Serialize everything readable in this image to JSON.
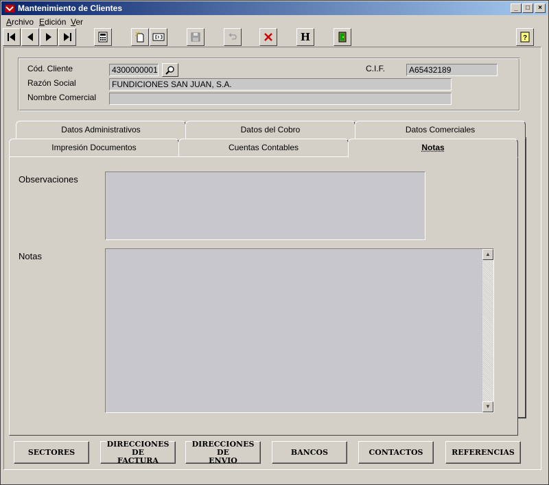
{
  "window": {
    "title": "Mantenimiento de Clientes"
  },
  "menu": [
    {
      "first": "A",
      "rest": "rchivo"
    },
    {
      "first": "E",
      "rest": "dición"
    },
    {
      "first": "V",
      "rest": "er"
    }
  ],
  "toolbar": {
    "icons": [
      "first-record-icon",
      "prev-record-icon",
      "next-record-icon",
      "last-record-icon",
      "calculator-icon",
      "new-record-icon",
      "edit-record-icon",
      "save-icon",
      "undo-icon",
      "delete-icon",
      "history-icon",
      "exit-icon",
      "help-icon"
    ],
    "history_label": "H"
  },
  "header": {
    "cod_cliente_label": "Cód. Cliente",
    "cod_cliente_value": "4300000001",
    "cif_label": "C.I.F.",
    "cif_value": "A65432189",
    "razon_social_label": "Razón Social",
    "razon_social_value": "FUNDICIONES SAN JUAN, S.A.",
    "nombre_comercial_label": "Nombre Comercial",
    "nombre_comercial_value": ""
  },
  "tabs": {
    "row1": [
      "Datos Administrativos",
      "Datos del Cobro",
      "Datos Comerciales"
    ],
    "row2": [
      "Impresión Documentos",
      "Cuentas Contables",
      "Notas"
    ],
    "active": "Notas"
  },
  "notas_tab": {
    "observaciones_label": "Observaciones",
    "notas_label": "Notas",
    "observaciones_value": "",
    "notas_value": ""
  },
  "bottom_buttons": [
    "SECTORES",
    "DIRECCIONES DE\nFACTURA",
    "DIRECCIONES DE\nENVIO",
    "BANCOS",
    "CONTACTOS",
    "REFERENCIAS"
  ],
  "colors": {
    "titlebar_start": "#0a246a",
    "titlebar_end": "#a6caf0",
    "face": "#d4d0c8",
    "field": "#c8c8c8",
    "delete": "#cc0000"
  }
}
